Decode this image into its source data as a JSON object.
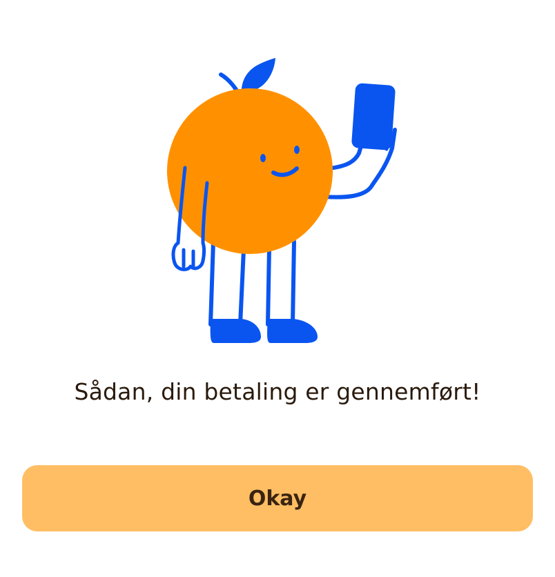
{
  "dialog": {
    "message": "Sådan, din betaling er gennemført!",
    "button_label": "Okay"
  },
  "illustration": {
    "icon": "orange-mascot-holding-phone-illustration",
    "colors": {
      "orange": "#ff9100",
      "blue": "#0a55f0"
    }
  },
  "colors": {
    "button_background": "#ffbe64",
    "button_text": "#3a2410",
    "message_text": "#2a1a0c",
    "background": "#ffffff"
  }
}
